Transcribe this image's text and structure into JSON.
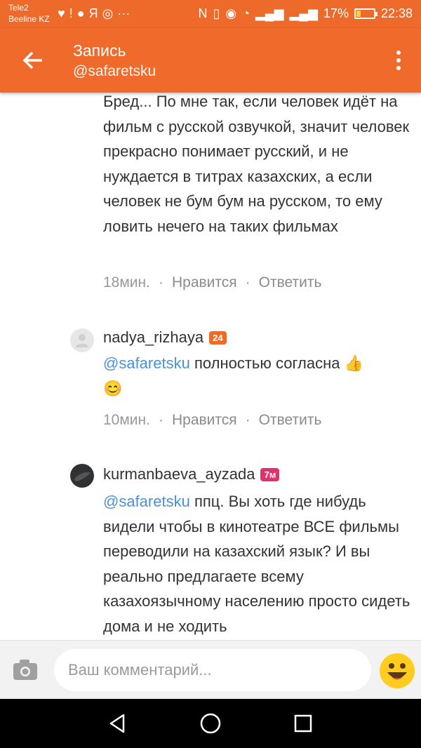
{
  "status_bar": {
    "carrier_1": "Tele2",
    "carrier_2": "Beeline KZ",
    "battery_percent": "17%",
    "time": "22:38"
  },
  "app_bar": {
    "title": "Запись",
    "subtitle": "@safaretsku"
  },
  "comments": [
    {
      "text": "Бред... По мне так, если человек идёт на фильм с русской озвучкой, значит человек прекрасно понимает русский, и не нуждается в титрах казахских, а если человек не бум бум на русском, то ему ловить нечего на таких фильмах",
      "time": "18мин.",
      "like_label": "Нравится",
      "reply_label": "Ответить"
    },
    {
      "author": "nadya_rizhaya",
      "badge": "24",
      "mention": "@safaretsku",
      "text": " полностью согласна ",
      "emoji_1": "👍",
      "emoji_2": "😊",
      "time": "10мин.",
      "like_label": "Нравится",
      "reply_label": "Ответить"
    },
    {
      "author": "kurmanbaeva_ayzada",
      "badge": "7м",
      "mention": "@safaretsku",
      "text": " ппц. Вы хоть где нибудь видели чтобы в кинотеатре ВСЕ фильмы переводили на казахский язык? И вы реально предлагаете всему казахоязычному населению просто сидеть дома и не ходить"
    }
  ],
  "input": {
    "placeholder": "Ваш комментарий..."
  },
  "colors": {
    "accent": "#ef6a2b",
    "mention": "#4a90d9",
    "badge_pink": "#e2306f"
  }
}
